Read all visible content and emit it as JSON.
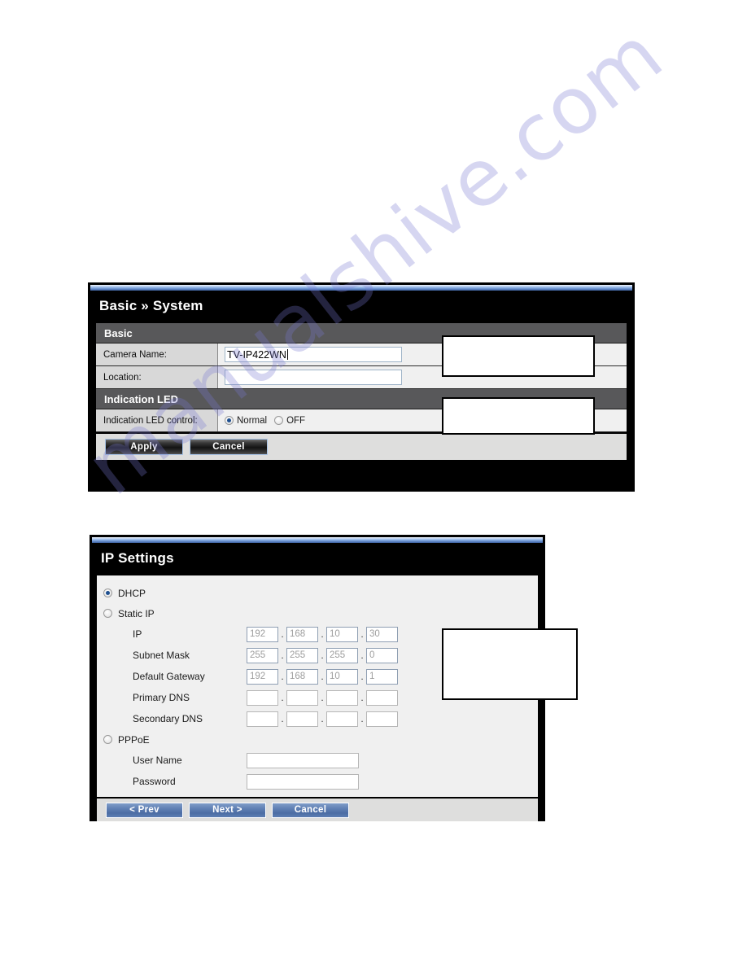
{
  "watermark": {
    "text": "manualshive.com"
  },
  "panel_system": {
    "title_prefix": "Basic",
    "title_separator": "»",
    "title_suffix": "System",
    "title_full": "Basic » System",
    "sections": [
      {
        "header": "Basic",
        "rows": [
          {
            "label": "Camera Name:",
            "value": "TV-IP422WN",
            "placeholder": ""
          },
          {
            "label": "Location:",
            "value": "",
            "placeholder": ""
          }
        ]
      },
      {
        "header": "Indication LED",
        "rows": [
          {
            "label": "Indication LED control:",
            "options": [
              {
                "label": "Normal",
                "selected": true
              },
              {
                "label": "OFF",
                "selected": false
              }
            ]
          }
        ]
      }
    ],
    "buttons": [
      {
        "label": "Apply"
      },
      {
        "label": "Cancel"
      }
    ]
  },
  "panel_ip": {
    "title_full": "IP Settings",
    "modes": [
      {
        "label": "DHCP",
        "selected": true
      },
      {
        "label": "Static IP",
        "selected": false
      },
      {
        "label": "PPPoE",
        "selected": false
      }
    ],
    "static_fields": [
      {
        "label": "IP",
        "octets": [
          "192",
          "168",
          "10",
          "30"
        ]
      },
      {
        "label": "Subnet Mask",
        "octets": [
          "255",
          "255",
          "255",
          "0"
        ]
      },
      {
        "label": "Default Gateway",
        "octets": [
          "192",
          "168",
          "10",
          "1"
        ]
      },
      {
        "label": "Primary DNS",
        "octets": [
          "",
          "",
          "",
          ""
        ]
      },
      {
        "label": "Secondary DNS",
        "octets": [
          "",
          "",
          "",
          ""
        ]
      }
    ],
    "pppoe_fields": [
      {
        "label": "User Name",
        "value": ""
      },
      {
        "label": "Password",
        "value": ""
      }
    ],
    "buttons": [
      {
        "label": "< Prev"
      },
      {
        "label": "Next >"
      },
      {
        "label": "Cancel"
      }
    ]
  },
  "colors": {
    "panel_frame": "#000000",
    "section_header": "#58585a",
    "row_label_bg": "#d8d8d8",
    "row_value_bg": "#f0f0f0",
    "title_strip_accent": "#93b6e8",
    "blue_button": "#5f7fb3",
    "radio_dot": "#1d4e8f"
  }
}
